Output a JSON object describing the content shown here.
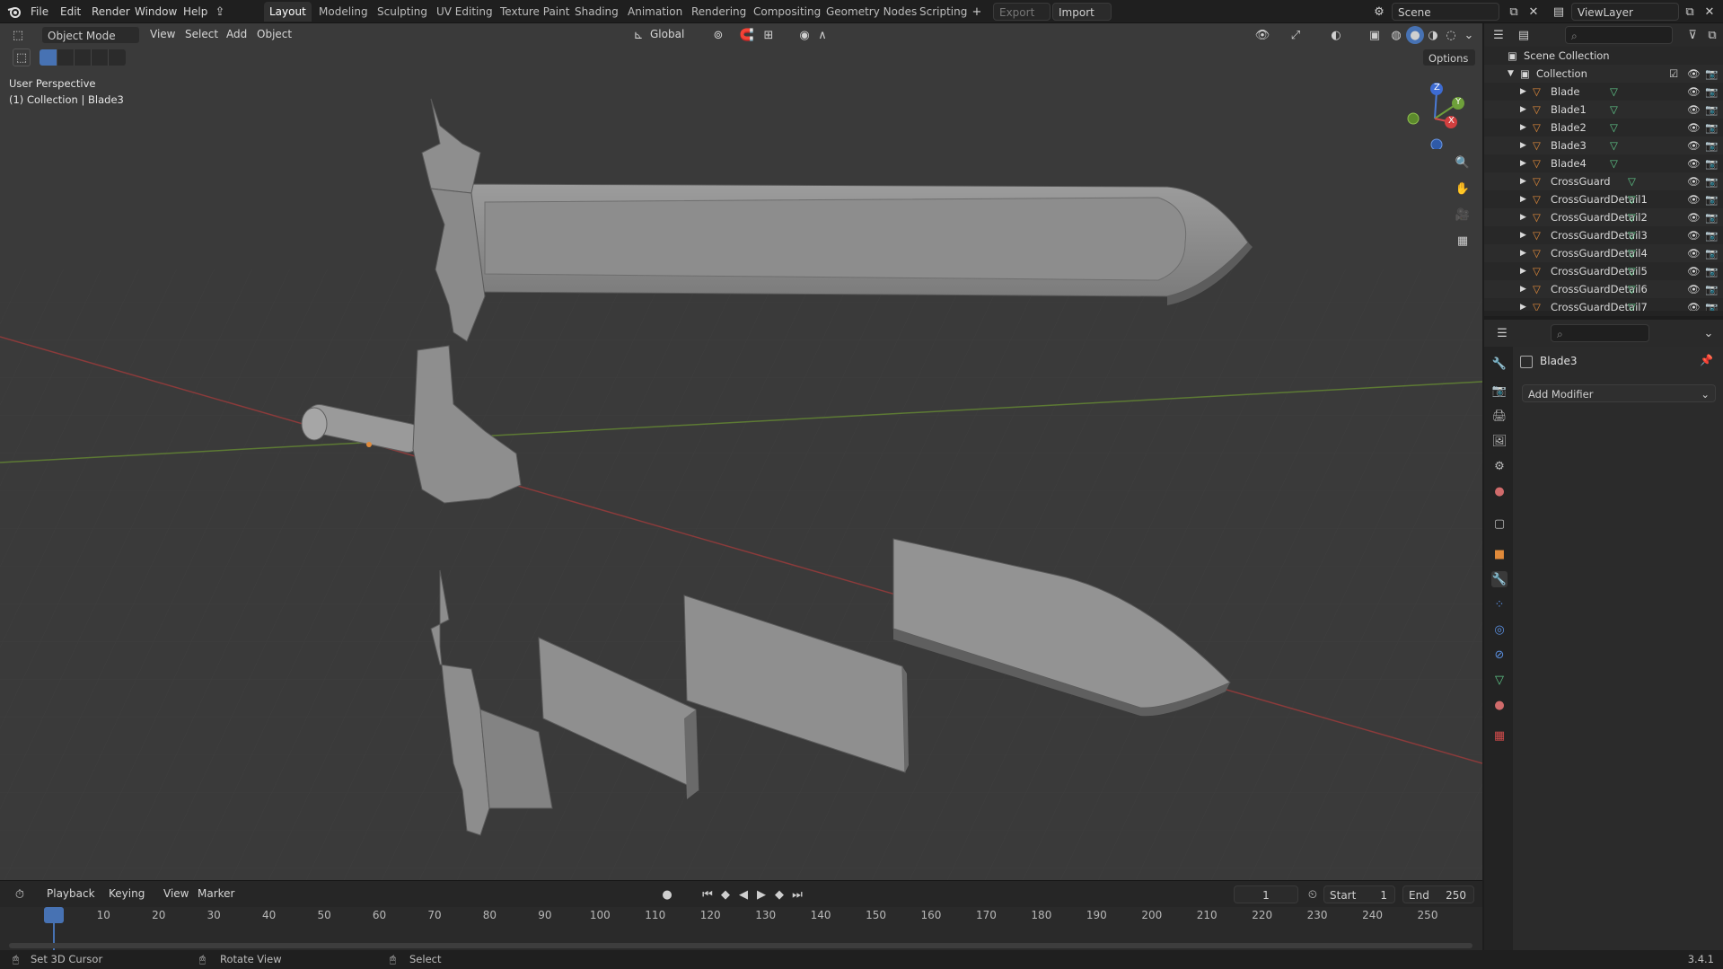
{
  "menu": [
    "File",
    "Edit",
    "Render",
    "Window",
    "Help"
  ],
  "workspaces": [
    "Layout",
    "Modeling",
    "Sculpting",
    "UV Editing",
    "Texture Paint",
    "Shading",
    "Animation",
    "Rendering",
    "Compositing",
    "Geometry Nodes",
    "Scripting"
  ],
  "active_workspace": "Layout",
  "export_label": "Export",
  "import_label": "Import",
  "scene_label": "Scene",
  "viewlayer_label": "ViewLayer",
  "viewport_header": {
    "mode": "Object Mode",
    "menus": [
      "View",
      "Select",
      "Add",
      "Object"
    ],
    "orientation": "Global",
    "options_label": "Options"
  },
  "viewport_overlay": {
    "perspective": "User Perspective",
    "collection_info": "(1) Collection | Blade3"
  },
  "gizmo": {
    "z": "Z",
    "y": "Y",
    "x": "X"
  },
  "outliner": {
    "scene_collection": "Scene Collection",
    "collection": "Collection",
    "items": [
      "Blade",
      "Blade1",
      "Blade2",
      "Blade3",
      "Blade4",
      "CrossGuard",
      "CrossGuardDetail1",
      "CrossGuardDetail2",
      "CrossGuardDetail3",
      "CrossGuardDetail4",
      "CrossGuardDetail5",
      "CrossGuardDetail6",
      "CrossGuardDetail7"
    ]
  },
  "properties": {
    "object_name": "Blade3",
    "add_modifier": "Add Modifier"
  },
  "timeline": {
    "menus": [
      "Playback",
      "Keying",
      "View",
      "Marker"
    ],
    "current_frame": "1",
    "start_label": "Start",
    "start_value": "1",
    "end_label": "End",
    "end_value": "250",
    "ticks": [
      "1",
      "10",
      "20",
      "30",
      "40",
      "50",
      "60",
      "70",
      "80",
      "90",
      "100",
      "110",
      "120",
      "130",
      "140",
      "150",
      "160",
      "170",
      "180",
      "190",
      "200",
      "210",
      "220",
      "230",
      "240",
      "250"
    ]
  },
  "statusbar": {
    "hint1": "Set 3D Cursor",
    "hint2": "Rotate View",
    "hint3": "Select",
    "version": "3.4.1"
  },
  "colors": {
    "accent": "#4772b3",
    "mesh_orange": "#e08a3a",
    "mesh_green": "#5fc88a",
    "axis_red": "#a03a3a",
    "axis_green": "#6a8a3a"
  }
}
